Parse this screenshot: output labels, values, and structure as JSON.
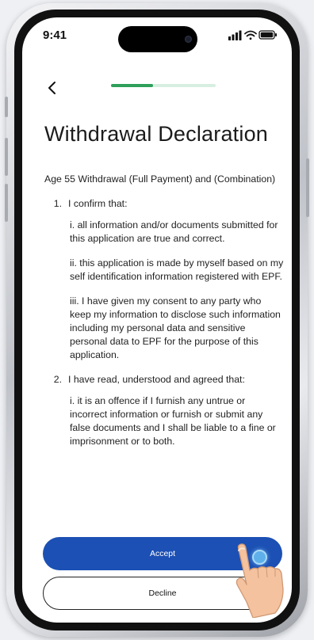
{
  "status": {
    "time": "9:41"
  },
  "header": {
    "progress": 0.4
  },
  "page": {
    "title": "Withdrawal Declaration"
  },
  "declaration": {
    "intro": "Age 55 Withdrawal (Full Payment) and (Combination)",
    "items": [
      {
        "number": "1.",
        "label": "I confirm that:",
        "subs": [
          "i. all information and/or documents submitted for this application are true and correct.",
          "ii. this application is made by myself based on my self identification information registered with EPF.",
          "iii. I have given my consent to any party who keep my information to disclose such information including my personal data and sensitive personal data to EPF for the purpose of this application."
        ]
      },
      {
        "number": "2.",
        "label": "I have read, understood and agreed that:",
        "subs": [
          "i. it is an offence if I furnish any untrue or incorrect information or furnish or submit any false documents and I shall be liable to a fine or imprisonment or to both."
        ]
      }
    ]
  },
  "actions": {
    "accept_label": "Accept",
    "decline_label": "Decline"
  },
  "colors": {
    "primary": "#1c50b4",
    "progress": "#2ea05a",
    "progress_track": "#d7efe1"
  },
  "icons": [
    "back-chevron-icon",
    "signal-icon",
    "wifi-icon",
    "battery-icon"
  ]
}
